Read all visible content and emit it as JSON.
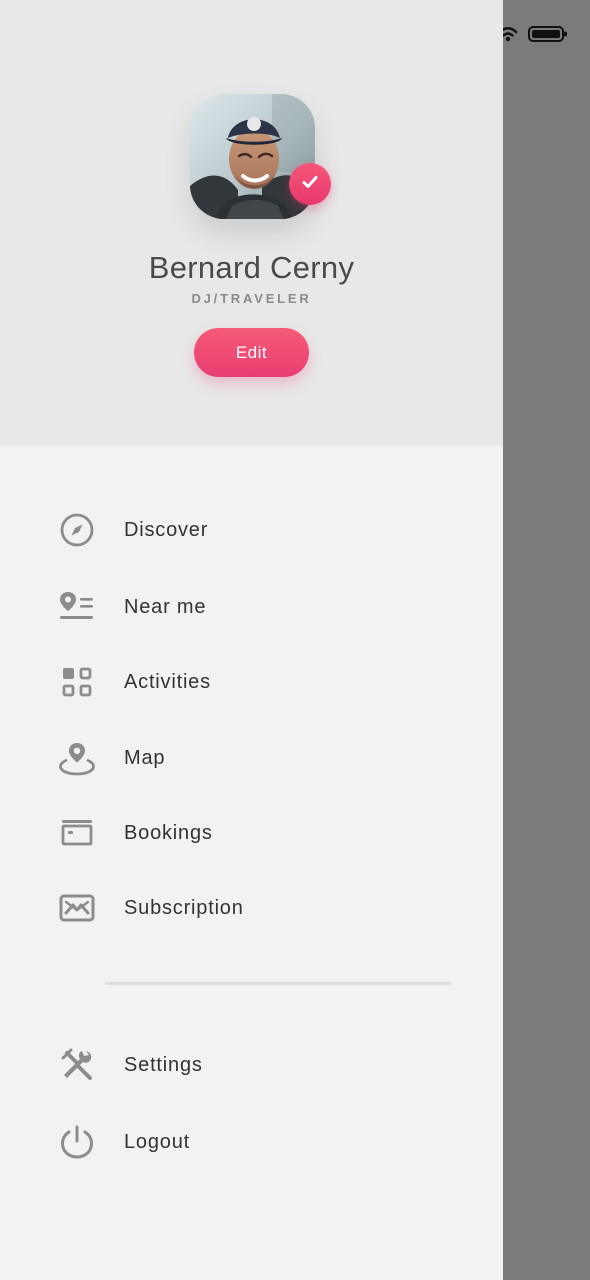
{
  "profile": {
    "name": "Bernard Cerny",
    "role": "DJ/TRAVELER",
    "edit_label": "Edit",
    "verified_icon": "check-icon"
  },
  "menu": {
    "items": [
      {
        "label": "Discover",
        "icon": "compass-icon"
      },
      {
        "label": "Near me",
        "icon": "location-list-icon"
      },
      {
        "label": "Activities",
        "icon": "grid-icon"
      },
      {
        "label": "Map",
        "icon": "map-pin-icon"
      },
      {
        "label": "Bookings",
        "icon": "card-icon"
      },
      {
        "label": "Subscription",
        "icon": "mail-icon"
      }
    ],
    "secondary_items": [
      {
        "label": "Settings",
        "icon": "tools-icon"
      },
      {
        "label": "Logout",
        "icon": "power-icon"
      }
    ]
  },
  "colors": {
    "accent": "#E93D72",
    "drawer_background": "#F2F2F2",
    "profile_background": "#E8E8E8",
    "overlay": "#7B7B7B",
    "icon": "#8C8C8C",
    "text": "#333333"
  }
}
